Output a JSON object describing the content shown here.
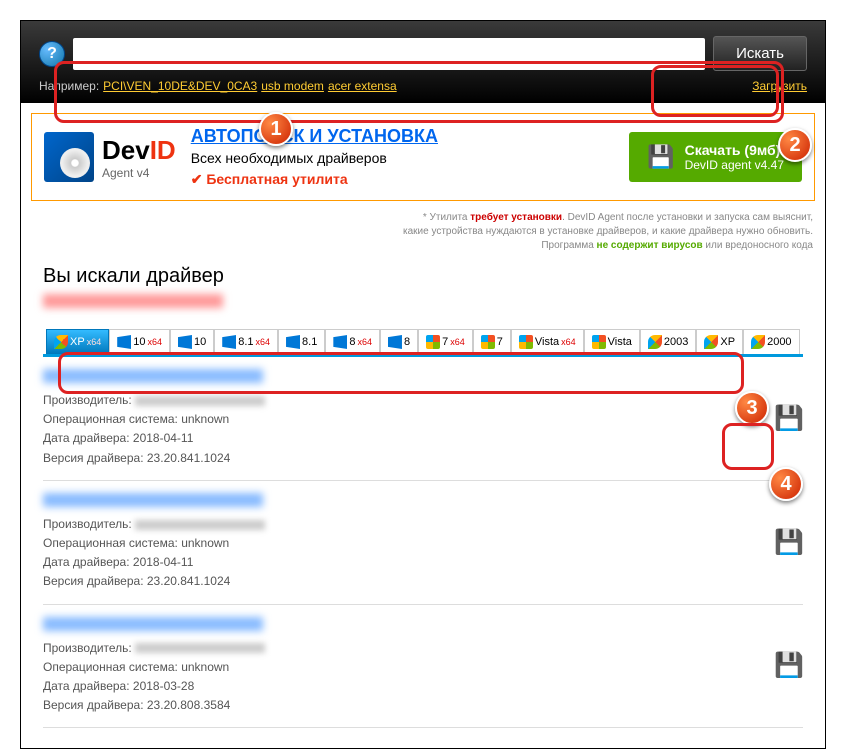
{
  "search": {
    "placeholder": "",
    "button": "Искать",
    "example_label": "Например:",
    "examples": [
      "PCI\\VEN_10DE&DEV_0CA3",
      "usb modem",
      "acer extensa"
    ],
    "upload": "Загрузить"
  },
  "promo": {
    "logo_dev": "Dev",
    "logo_id": "ID",
    "agent": "Agent v4",
    "title": "АВТОПОИСК И УСТАНОВКА",
    "subtitle": "Всех необходимых драйверов",
    "free": "Бесплатная утилита",
    "dl_label": "Скачать (9мб)",
    "dl_sub": "DevID agent v4.47"
  },
  "disclaimer": {
    "line1a": "* Утилита ",
    "line1b": "требует установки",
    "line1c": ". DevID Agent после установки и запуска сам выяснит,",
    "line2": "какие устройства нуждаются в установке драйверов, и какие драйвера нужно обновить.",
    "line3a": "Программа ",
    "line3b": "не содержит вирусов",
    "line3c": " или вредоносного кода"
  },
  "results": {
    "title": "Вы искали драйвер",
    "labels": {
      "manufacturer": "Производитель:",
      "os": "Операционная система:",
      "date": "Дата драйвера:",
      "version": "Версия драйвера:"
    },
    "items": [
      {
        "os": "unknown",
        "date": "2018-04-11",
        "version": "23.20.841.1024"
      },
      {
        "os": "unknown",
        "date": "2018-04-11",
        "version": "23.20.841.1024"
      },
      {
        "os": "unknown",
        "date": "2018-03-28",
        "version": "23.20.808.3584"
      }
    ]
  },
  "os_tabs": [
    {
      "label": "XP",
      "x64": true,
      "icon": "old",
      "active": true
    },
    {
      "label": "10",
      "x64": true,
      "icon": "new"
    },
    {
      "label": "10",
      "x64": false,
      "icon": "new"
    },
    {
      "label": "8.1",
      "x64": true,
      "icon": "new"
    },
    {
      "label": "8.1",
      "x64": false,
      "icon": "new"
    },
    {
      "label": "8",
      "x64": true,
      "icon": "new"
    },
    {
      "label": "8",
      "x64": false,
      "icon": "new"
    },
    {
      "label": "7",
      "x64": true,
      "icon": "seven"
    },
    {
      "label": "7",
      "x64": false,
      "icon": "seven"
    },
    {
      "label": "Vista",
      "x64": true,
      "icon": "seven"
    },
    {
      "label": "Vista",
      "x64": false,
      "icon": "seven"
    },
    {
      "label": "2003",
      "x64": false,
      "icon": "old"
    },
    {
      "label": "XP",
      "x64": false,
      "icon": "old"
    },
    {
      "label": "2000",
      "x64": false,
      "icon": "old"
    }
  ],
  "markers": [
    "1",
    "2",
    "3",
    "4"
  ]
}
